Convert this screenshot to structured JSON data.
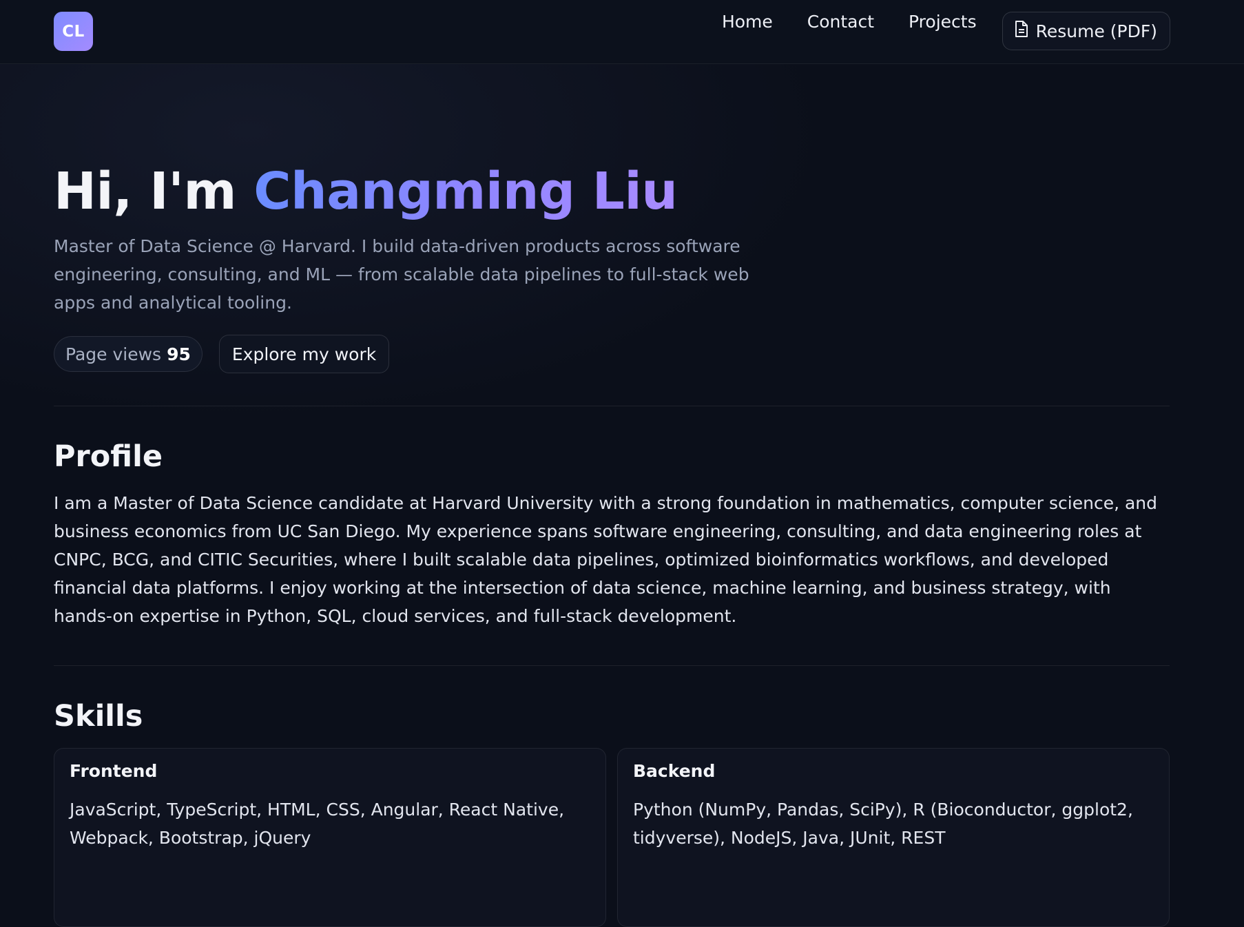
{
  "header": {
    "logo_text": "CL",
    "nav": [
      {
        "label": "Home"
      },
      {
        "label": "Contact"
      },
      {
        "label": "Projects"
      }
    ],
    "resume_label": "Resume (PDF)",
    "resume_icon": "document-icon"
  },
  "hero": {
    "greeting": "Hi, I'm ",
    "name": "Changming Liu",
    "subtitle": "Master of Data Science @ Harvard. I build data-driven products across software engineering, consulting, and ML — from scalable data pipelines to full-stack web apps and analytical tooling.",
    "views_label": "Page views",
    "views_count": "95",
    "explore_label": "Explore my work"
  },
  "profile": {
    "title": "Profile",
    "text": "I am a Master of Data Science candidate at Harvard University with a strong foundation in mathematics, computer science, and business economics from UC San Diego. My experience spans software engineering, consulting, and data engineering roles at CNPC, BCG, and CITIC Securities, where I built scalable data pipelines, optimized bioinformatics workflows, and developed financial data platforms. I enjoy working at the intersection of data science, machine learning, and business strategy, with hands-on expertise in Python, SQL, cloud services, and full-stack development."
  },
  "skills": {
    "title": "Skills",
    "cards": [
      {
        "title": "Frontend",
        "text": "JavaScript, TypeScript, HTML, CSS, Angular, React Native, Webpack, Bootstrap, jQuery"
      },
      {
        "title": "Backend",
        "text": "Python (NumPy, Pandas, SciPy), R (Bioconductor, ggplot2, tidyverse), NodeJS, Java, JUnit, REST"
      }
    ]
  },
  "colors": {
    "background": "#0b0f1a",
    "accent_gradient_start": "#6a8cff",
    "accent_gradient_end": "#a98bff"
  }
}
